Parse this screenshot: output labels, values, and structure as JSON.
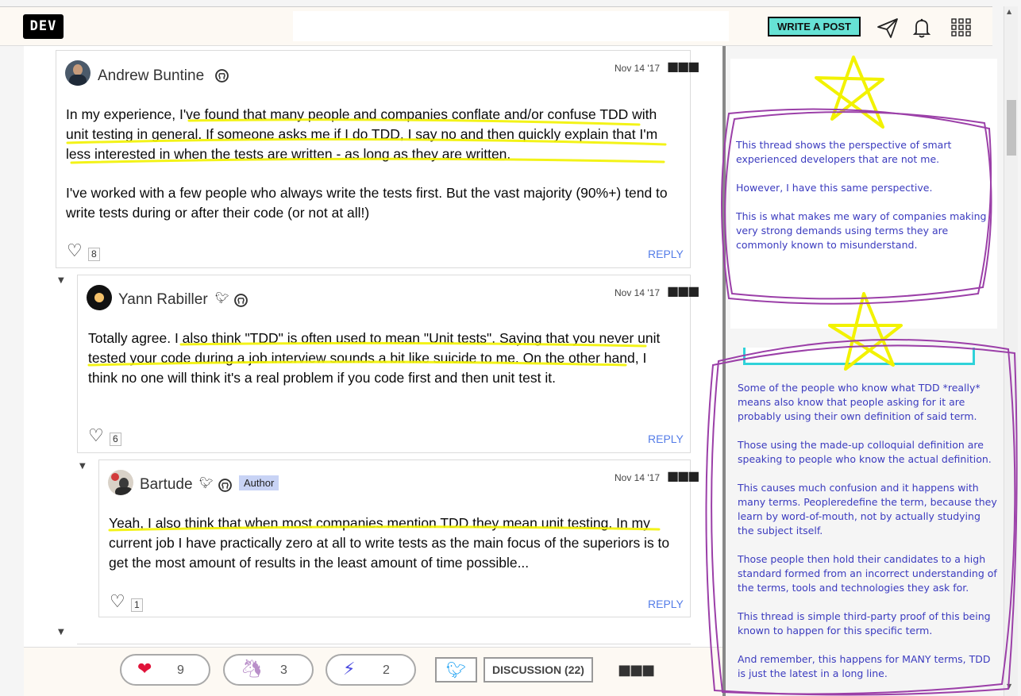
{
  "topbar": {
    "logo": "DEV",
    "search_placeholder": "",
    "write_post": "WRITE A POST",
    "icons": [
      "paper-plane-icon",
      "bell-icon",
      "grid-menu-icon"
    ]
  },
  "comments": [
    {
      "author": "Andrew Buntine",
      "date": "Nov 14 '17",
      "paragraphs": [
        "In my experience, I've found that many people and companies conflate and/or confuse TDD with unit testing in general. If someone asks me if I do TDD, I say no and then quickly explain that I'm less interested in when the tests are written - as long as they are written.",
        "I've worked with a few people who always write the tests first. But the vast majority (90%+) tend to write tests during or after their code (or not at all!)"
      ],
      "likes": "8",
      "reply": "REPLY"
    },
    {
      "author": "Yann Rabiller",
      "date": "Nov 14 '17",
      "paragraphs": [
        "Totally agree. I also think \"TDD\" is often used to mean \"Unit tests\". Saying that you never unit tested your code during a job interview sounds a bit like suicide to me. On the other hand, I think no one will think it's a real problem if you code first and then unit test it."
      ],
      "likes": "6",
      "reply": "REPLY"
    },
    {
      "author": "Bartude",
      "author_tag": "Author",
      "date": "Nov 14 '17",
      "paragraphs": [
        "Yeah, I also think that when most companies mention TDD they mean unit testing. In my current job I have practically zero at all to write tests as the main focus of the superiors is to get the most amount of results in the least amount of time possible..."
      ],
      "likes": "1",
      "reply": "REPLY"
    }
  ],
  "bottombar": {
    "reactions": [
      {
        "icon": "heart-icon",
        "count": "9"
      },
      {
        "icon": "unicorn-icon",
        "count": "3"
      },
      {
        "icon": "bookmark-icon",
        "count": "2"
      }
    ],
    "discussion": "DISCUSSION (22)"
  },
  "notes": {
    "first": [
      "This thread shows the perspective of smart experienced developers that are not me.",
      "However, I have this same perspective.",
      "This is what makes me wary of companies making very strong demands using terms they are commonly known to misunderstand."
    ],
    "second": [
      "Some of the people who know what TDD *really* means also know that people asking for it are probably using their own definition of said term.",
      "Those using the made-up colloquial definition are speaking to people who know the actual definition.",
      "This causes much confusion and it happens with many terms. Peopleredefine the term, because they learn by word-of-mouth, not by actually studying the subject itself.",
      "Those people then hold their candidates to a high standard formed from an incorrect understanding of the terms, tools and technologies they ask for.",
      "This thread is simple third-party proof of this being known to happen for this specific term.",
      "And remember, this happens for MANY terms, TDD is just the latest in a long line."
    ]
  },
  "colors": {
    "accent": "#66e2d5",
    "highlight": "#ffff00",
    "annotation": "#9b3fa8",
    "note_text": "#3b3bbf",
    "link": "#557de8"
  }
}
